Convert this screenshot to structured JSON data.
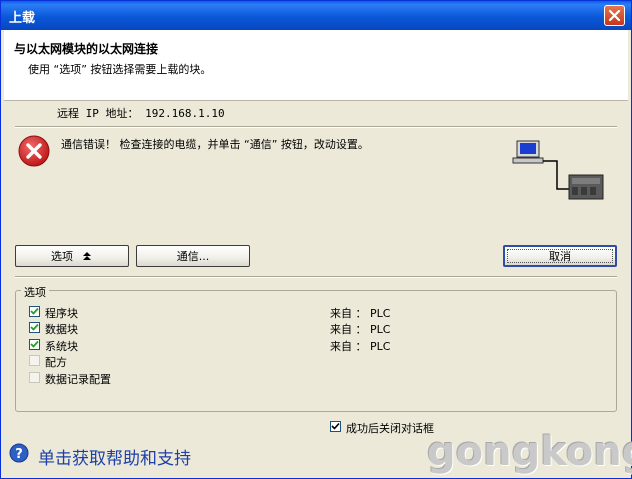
{
  "window": {
    "title": "上载"
  },
  "header": {
    "title": "与以太网模块的以太网连接",
    "subtitle": "使用 “选项” 按钮选择需要上载的块。"
  },
  "remote_ip": "远程 IP 地址： 192.168.1.10",
  "error": {
    "message": "通信错误！ 检查连接的电缆，并单击 “通信” 按钮，改动设置。"
  },
  "buttons": {
    "options_label": "选项",
    "options_icon": "double-chevron-up-icon",
    "comm_label": "通信...",
    "cancel_label": "取消"
  },
  "options_group": {
    "label": "选项",
    "items": [
      {
        "label": "程序块",
        "checked": true,
        "enabled": true,
        "source": "来自 ： PLC"
      },
      {
        "label": "数据块",
        "checked": true,
        "enabled": true,
        "source": "来自 ： PLC"
      },
      {
        "label": "系统块",
        "checked": true,
        "enabled": true,
        "source": "来自 ： PLC"
      },
      {
        "label": "配方",
        "checked": false,
        "enabled": false,
        "source": ""
      },
      {
        "label": "数据记录配置",
        "checked": false,
        "enabled": false,
        "source": ""
      }
    ]
  },
  "close_on_success": {
    "label": "成功后关闭对话框",
    "checked": true
  },
  "help": {
    "label": "单击获取帮助和支持"
  },
  "watermark": "gongkong",
  "colors": {
    "titlebar": "#0a58d8",
    "error_red": "#d42020",
    "help_blue": "#1c3fa8"
  }
}
